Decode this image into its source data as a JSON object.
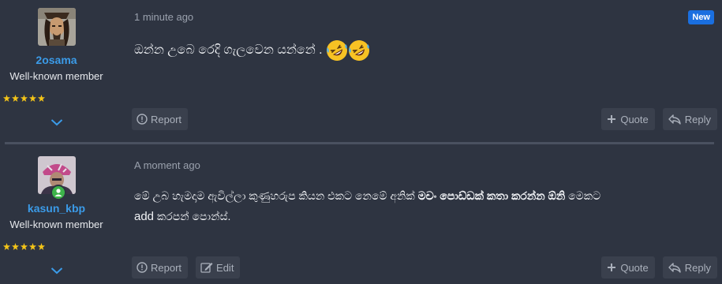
{
  "posts": [
    {
      "author": "2osama",
      "user_title": "Well-known member",
      "timestamp": "1 minute ago",
      "badge": "New",
      "message_text": "ඔන්න උබෙ රෙදි ගැලවෙන යන්නේ .",
      "emojis": [
        "rolling-on-floor-laughing",
        "rolling-on-floor-laughing"
      ],
      "stars": 5,
      "actions_left": [
        "Report"
      ],
      "actions_right": [
        "Quote",
        "Reply"
      ]
    },
    {
      "author": "kasun_kbp",
      "user_title": "Well-known member",
      "timestamp": "A moment ago",
      "online": true,
      "message_line1_a": "මේ උබ හැමදාම ඇවිල්ලා කුණුහරුප කියන එකට නෙමේ අනික් ",
      "message_line1_bold": "මචං පොඩ්ඩක් කතා කරන්න ඕනි",
      "message_line1_b": " මෙකට",
      "message_line2_latin": "add",
      "message_line2_rest": " කරපන් පොන්ස්.",
      "stars": 5,
      "actions_left": [
        "Report",
        "Edit"
      ],
      "actions_right": [
        "Quote",
        "Reply"
      ]
    }
  ],
  "colors": {
    "background": "#2e3441",
    "username": "#3b9be8",
    "badge": "#1a6fe0",
    "star": "#f5c518",
    "online": "#3db34a",
    "button_bg": "#3a404d"
  }
}
